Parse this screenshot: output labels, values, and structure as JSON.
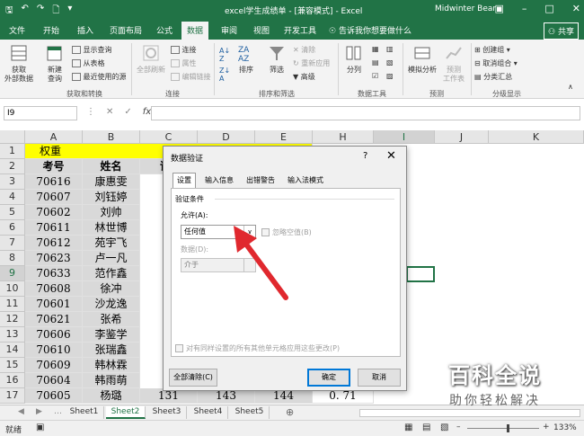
{
  "title": {
    "filename": "excel学生成绩单",
    "mode": "[兼容模式]",
    "app": "Excel",
    "user": "Midwinter Bear"
  },
  "tabs": [
    "文件",
    "开始",
    "插入",
    "页面布局",
    "公式",
    "数据",
    "审阅",
    "视图",
    "开发工具"
  ],
  "active_tab": "数据",
  "tell_me": "告诉我你想要做什么",
  "share": "共享",
  "ribbon": {
    "get_data": [
      "获取",
      "外部数据"
    ],
    "new_query": [
      "新建",
      "查询"
    ],
    "show_query": "显示查询",
    "from_table": "从表格",
    "recent_source": "最近使用的源",
    "group_get": "获取和转换",
    "refresh_all": "全部刷新",
    "connections": "连接",
    "properties": "属性",
    "edit_links": "编辑链接",
    "group_conn": "连接",
    "sort": "排序",
    "filter": "筛选",
    "clear": "清除",
    "reapply": "重新应用",
    "advanced": "高级",
    "group_sort": "排序和筛选",
    "text_to_columns": "分列",
    "group_tools": "数据工具",
    "what_if": "模拟分析",
    "forecast_sheet": [
      "预测",
      "工作表"
    ],
    "group_forecast": "预测",
    "group": "创建组",
    "ungroup": "取消组合",
    "subtotal": "分类汇总",
    "group_outline": "分级显示"
  },
  "namebox": "I9",
  "columns": [
    "A",
    "B",
    "C",
    "D",
    "E",
    "H",
    "I",
    "J",
    "K"
  ],
  "rows": [
    {
      "n": "1",
      "a": "权重",
      "b": ""
    },
    {
      "n": "2",
      "a": "考号",
      "b": "姓名"
    },
    {
      "n": "3",
      "a": "70616",
      "b": "康惠雯"
    },
    {
      "n": "4",
      "a": "70607",
      "b": "刘钰婷"
    },
    {
      "n": "5",
      "a": "70602",
      "b": "刘帅"
    },
    {
      "n": "6",
      "a": "70611",
      "b": "林世博"
    },
    {
      "n": "7",
      "a": "70612",
      "b": "苑宇飞"
    },
    {
      "n": "8",
      "a": "70623",
      "b": "卢一凡"
    },
    {
      "n": "9",
      "a": "70633",
      "b": "范作鑫"
    },
    {
      "n": "10",
      "a": "70608",
      "b": "徐冲"
    },
    {
      "n": "11",
      "a": "70601",
      "b": "沙龙逸"
    },
    {
      "n": "12",
      "a": "70621",
      "b": "张希"
    },
    {
      "n": "13",
      "a": "70606",
      "b": "李鉴学"
    },
    {
      "n": "14",
      "a": "70610",
      "b": "张瑞鑫"
    },
    {
      "n": "15",
      "a": "70609",
      "b": "韩林霖"
    },
    {
      "n": "16",
      "a": "70604",
      "b": "韩雨萌"
    },
    {
      "n": "17",
      "a": "70605",
      "b": "杨璐"
    }
  ],
  "row2_c": "语",
  "row17_extra": {
    "c": "131",
    "d": "143",
    "e": "144",
    "h": "0. 71"
  },
  "dialog": {
    "title": "数据验证",
    "help": "?",
    "tabs": [
      "设置",
      "输入信息",
      "出错警告",
      "输入法模式"
    ],
    "section": "验证条件",
    "allow_label": "允许(A):",
    "allow_value": "任何值",
    "ignore_blank": "忽略空值(B)",
    "data_label": "数据(D):",
    "data_value": "介于",
    "apply_all": "对有同样设置的所有其他单元格应用这些更改(P)",
    "clear_all": "全部清除(C)",
    "ok": "确定",
    "cancel": "取消"
  },
  "sheets": [
    "Sheet1",
    "Sheet2",
    "Sheet3",
    "Sheet4",
    "Sheet5"
  ],
  "active_sheet": "Sheet2",
  "status": {
    "ready": "就绪",
    "zoom": "133%"
  },
  "watermark": {
    "line1": "百科全说",
    "line2": "助你轻松解决"
  }
}
